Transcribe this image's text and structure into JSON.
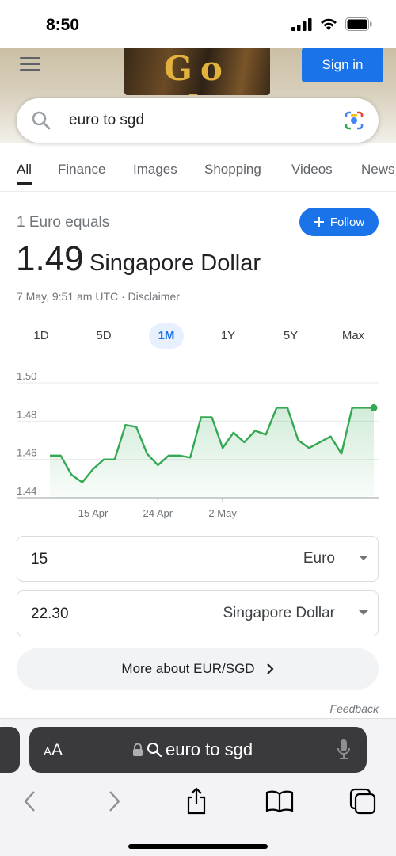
{
  "status": {
    "time": "8:50"
  },
  "header": {
    "doodle_text": "Go gle",
    "sign_in_label": "Sign in"
  },
  "search": {
    "query": "euro to sgd"
  },
  "tabs": [
    {
      "label": "All",
      "active": true
    },
    {
      "label": "Finance"
    },
    {
      "label": "Images"
    },
    {
      "label": "Shopping"
    },
    {
      "label": "Videos"
    },
    {
      "label": "News"
    }
  ],
  "converter": {
    "equals_label": "1 Euro equals",
    "follow_label": "Follow",
    "rate": "1.49",
    "rate_currency": "Singapore Dollar",
    "timestamp": "7 May, 9:51 am UTC · Disclaimer",
    "ranges": [
      "1D",
      "5D",
      "1M",
      "1Y",
      "5Y",
      "Max"
    ],
    "active_range": "1M",
    "from": {
      "value": "15",
      "currency": "Euro"
    },
    "to": {
      "value": "22.30",
      "currency": "Singapore Dollar"
    },
    "more_label": "More about EUR/SGD",
    "feedback_label": "Feedback"
  },
  "chart_data": {
    "type": "area",
    "y_ticks": [
      "1.50",
      "1.48",
      "1.46",
      "1.44"
    ],
    "ylim": [
      1.44,
      1.5
    ],
    "x_ticks": [
      {
        "label": "15 Apr",
        "index": 4
      },
      {
        "label": "24 Apr",
        "index": 10
      },
      {
        "label": "2 May",
        "index": 16
      }
    ],
    "values": [
      1.462,
      1.462,
      1.452,
      1.448,
      1.455,
      1.46,
      1.46,
      1.478,
      1.477,
      1.463,
      1.457,
      1.462,
      1.462,
      1.461,
      1.482,
      1.482,
      1.466,
      1.474,
      1.469,
      1.475,
      1.473,
      1.487,
      1.487,
      1.47,
      1.466,
      1.469,
      1.472,
      1.463,
      1.487,
      1.487,
      1.487
    ],
    "colors": {
      "line": "#34a853",
      "fill": "#e6f4ea",
      "grid": "#e8eaed",
      "axis": "#9aa0a6"
    }
  },
  "safari": {
    "address_text": "euro to sgd",
    "aa_label": "AA"
  }
}
